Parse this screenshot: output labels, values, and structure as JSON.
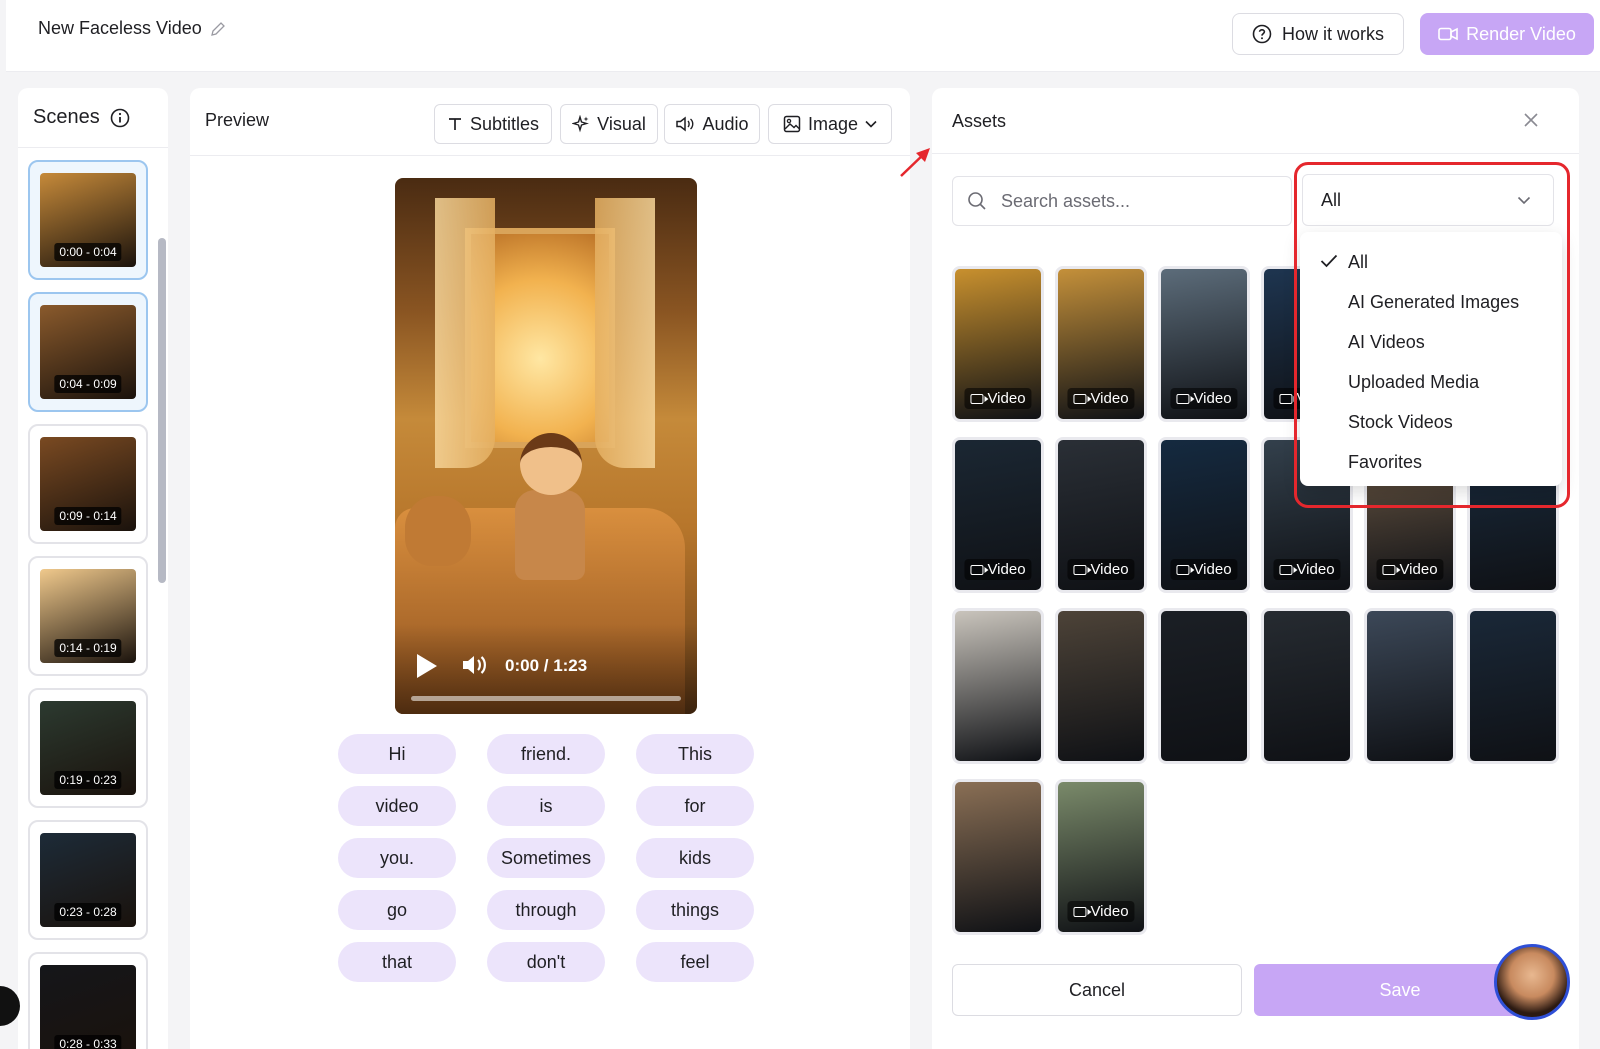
{
  "header": {
    "doc_title": "New Faceless Video",
    "how_it_works": "How it works",
    "render_video": "Render Video"
  },
  "scenes": {
    "title": "Scenes",
    "items": [
      {
        "time": "0:00 - 0:04",
        "active": true,
        "color": "#c68a3a"
      },
      {
        "time": "0:04 - 0:09",
        "active": true,
        "color": "#8a5a2c"
      },
      {
        "time": "0:09 - 0:14",
        "active": false,
        "color": "#7a4a22"
      },
      {
        "time": "0:14 - 0:19",
        "active": false,
        "color": "#f0c98c"
      },
      {
        "time": "0:19 - 0:23",
        "active": false,
        "color": "#2c3a30"
      },
      {
        "time": "0:23 - 0:28",
        "active": false,
        "color": "#1d2b38"
      },
      {
        "time": "0:28 - 0:33",
        "active": false,
        "color": "#15161a"
      }
    ]
  },
  "preview": {
    "title": "Preview",
    "tabs": {
      "subtitles": "Subtitles",
      "visual": "Visual",
      "audio": "Audio",
      "image": "Image"
    },
    "player": {
      "time_display": "0:00 / 1:23"
    },
    "words": [
      "Hi",
      "friend.",
      "This",
      "video",
      "is",
      "for",
      "you.",
      "Sometimes",
      "kids",
      "go",
      "through",
      "things",
      "that",
      "don't",
      "feel"
    ]
  },
  "assets": {
    "title": "Assets",
    "search_placeholder": "Search assets...",
    "filter_value": "All",
    "filter_options": [
      "All",
      "AI Generated Images",
      "AI Videos",
      "Uploaded Media",
      "Stock Videos",
      "Favorites"
    ],
    "video_tag": "Video",
    "items": [
      {
        "type": "video",
        "color": "#c8902e"
      },
      {
        "type": "video",
        "color": "#c4903a"
      },
      {
        "type": "video",
        "color": "#5c6c7a"
      },
      {
        "type": "video",
        "color": "#1e3550"
      },
      {
        "type": "none",
        "color": "#22354a"
      },
      {
        "type": "none",
        "color": "#1d2f44"
      },
      {
        "type": "video",
        "color": "#1b2733"
      },
      {
        "type": "video",
        "color": "#2a2f36"
      },
      {
        "type": "video",
        "color": "#152a40"
      },
      {
        "type": "video",
        "color": "#33404c"
      },
      {
        "type": "video",
        "color": "#6e5a46"
      },
      {
        "type": "none",
        "color": "#1a2c3f"
      },
      {
        "type": "none",
        "color": "#c9c4bc"
      },
      {
        "type": "none",
        "color": "#4d4338"
      },
      {
        "type": "none",
        "color": "#1b1f25"
      },
      {
        "type": "none",
        "color": "#262b31"
      },
      {
        "type": "none",
        "color": "#3c4858"
      },
      {
        "type": "none",
        "color": "#1a2838"
      },
      {
        "type": "none",
        "color": "#8a6f55"
      },
      {
        "type": "video",
        "color": "#7a8a6a"
      }
    ],
    "cancel": "Cancel",
    "save": "Save"
  },
  "colors": {
    "accent": "#c7a6f5",
    "word_chip": "#ece4fb",
    "highlight": "#e5272d",
    "active_scene_border": "#9cc6ef"
  }
}
